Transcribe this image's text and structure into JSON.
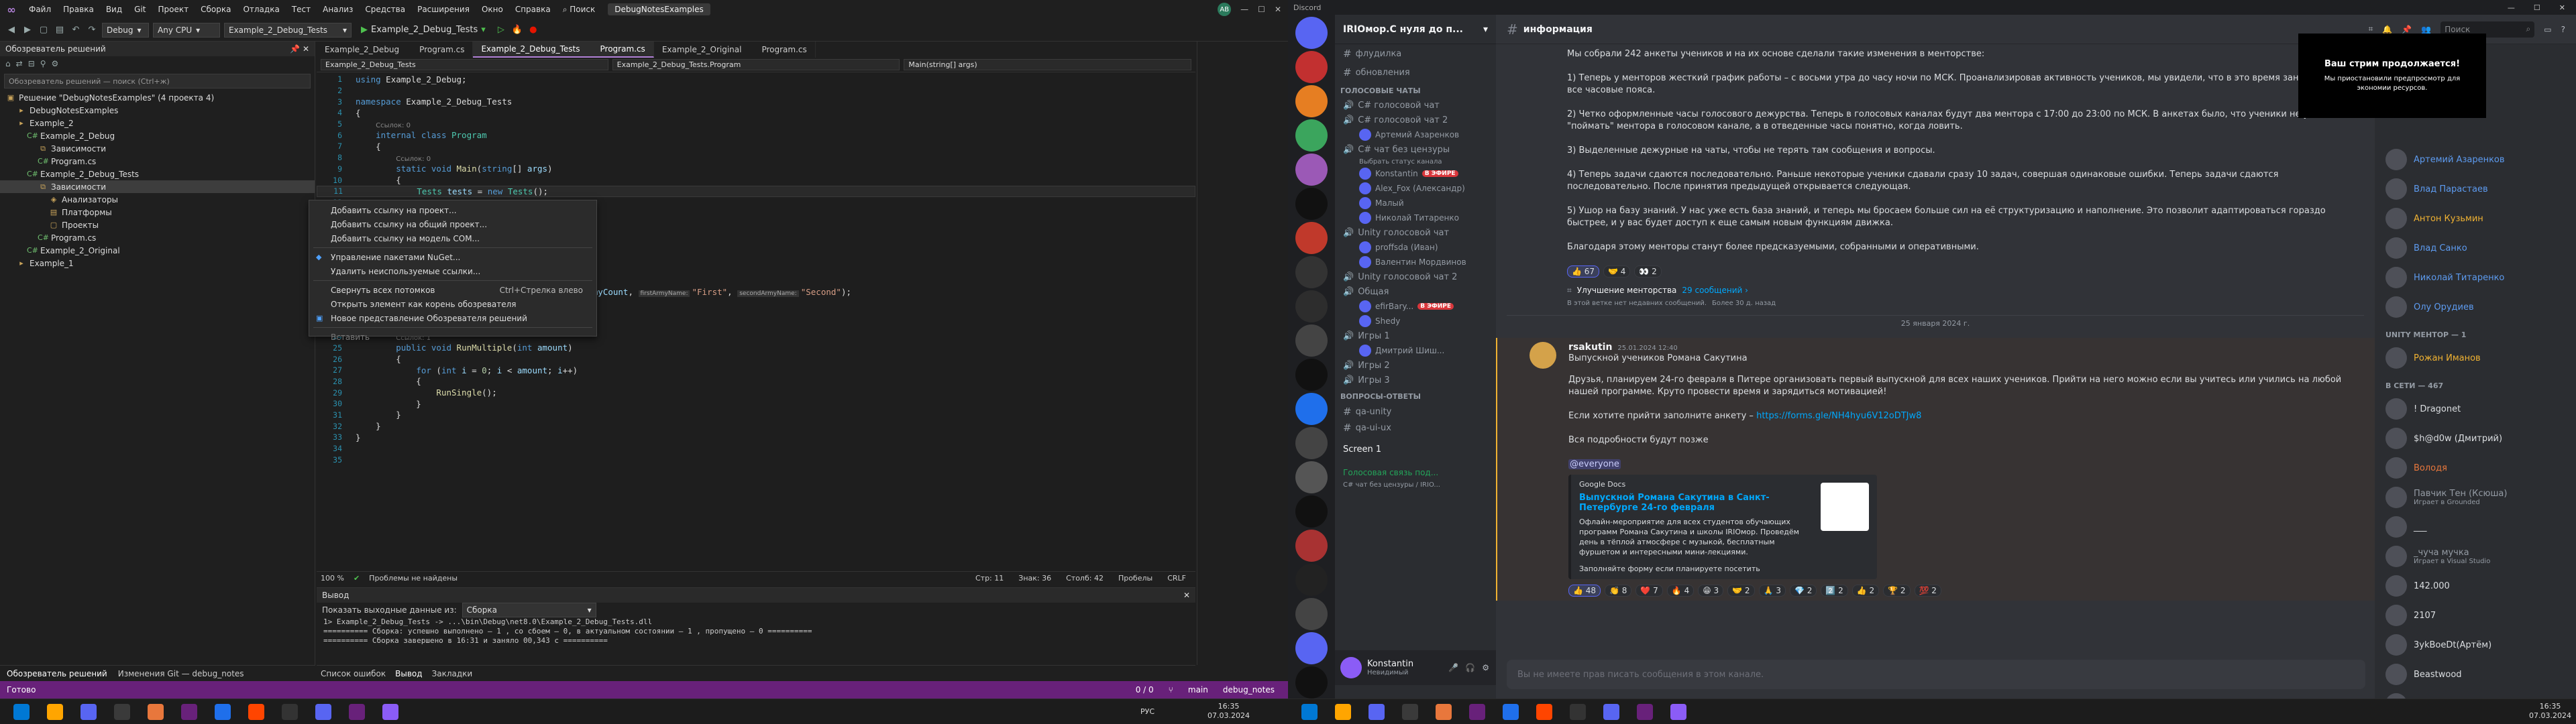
{
  "vs": {
    "menu": [
      "Файл",
      "Правка",
      "Вид",
      "Git",
      "Проект",
      "Сборка",
      "Отладка",
      "Тест",
      "Анализ",
      "Средства",
      "Расширения",
      "Окно",
      "Справка"
    ],
    "search": "Поиск",
    "solution_badge": "DebugNotesExamples",
    "avatar": "AB",
    "toolbar": {
      "config": "Debug",
      "platform": "Any CPU",
      "startup": "Example_2_Debug_Tests",
      "run_label": "Example_2_Debug_Tests"
    },
    "solution_explorer": {
      "title": "Обозреватель решений",
      "search_placeholder": "Обозреватель решений — поиск (Ctrl+ж)",
      "items": [
        {
          "label": "Решение \"DebugNotesExamples\" (4 проекта 4)",
          "indent": 0,
          "icon": "solution-icon"
        },
        {
          "label": "DebugNotesExamples",
          "indent": 1,
          "icon": "folder-icon"
        },
        {
          "label": "Example_2",
          "indent": 1,
          "icon": "folder-icon"
        },
        {
          "label": "Example_2_Debug",
          "indent": 2,
          "icon": "project-icon"
        },
        {
          "label": "Зависимости",
          "indent": 3,
          "icon": "dependencies-icon"
        },
        {
          "label": "Program.cs",
          "indent": 3,
          "icon": "csharp-file-icon"
        },
        {
          "label": "Example_2_Debug_Tests",
          "indent": 2,
          "icon": "project-icon"
        },
        {
          "label": "Зависимости",
          "indent": 3,
          "icon": "dependencies-icon",
          "selected": true
        },
        {
          "label": "Анализаторы",
          "indent": 4,
          "icon": "analyzer-icon"
        },
        {
          "label": "Платформы",
          "indent": 4,
          "icon": "framework-icon"
        },
        {
          "label": "Проекты",
          "indent": 4,
          "icon": "projects-icon"
        },
        {
          "label": "Program.cs",
          "indent": 3,
          "icon": "csharp-file-icon"
        },
        {
          "label": "Example_2_Original",
          "indent": 2,
          "icon": "project-icon"
        },
        {
          "label": "Example_1",
          "indent": 1,
          "icon": "folder-icon"
        }
      ],
      "tabs": [
        "Обозреватель решений",
        "Изменения Git — debug_notes"
      ]
    },
    "context_menu": [
      {
        "label": "Добавить ссылку на проект...",
        "icon": "",
        "shortcut": ""
      },
      {
        "label": "Добавить ссылку на общий проект...",
        "icon": "",
        "shortcut": ""
      },
      {
        "label": "Добавить ссылку на модель COM...",
        "icon": "",
        "shortcut": ""
      },
      {
        "sep": true
      },
      {
        "label": "Управление пакетами NuGet...",
        "icon": "◆",
        "shortcut": ""
      },
      {
        "label": "Удалить неиспользуемые ссылки...",
        "icon": "",
        "shortcut": ""
      },
      {
        "sep": true
      },
      {
        "label": "Свернуть всех потомков",
        "icon": "",
        "shortcut": "Ctrl+Стрелка влево"
      },
      {
        "label": "Открыть элемент как корень обозревателя",
        "icon": "",
        "shortcut": ""
      },
      {
        "label": "Новое представление Обозревателя решений",
        "icon": "▣",
        "shortcut": ""
      },
      {
        "sep": true
      },
      {
        "label": "Вставить",
        "icon": "",
        "shortcut": "",
        "disabled": true
      }
    ],
    "editor": {
      "tabs": [
        "Example_2_Debug",
        "Program.cs",
        "Example_2_Debug_Tests",
        "Program.cs",
        "Example_2_Original",
        "Program.cs"
      ],
      "active_tab": 1,
      "nav": [
        "Example_2_Debug_Tests",
        "Example_2_Debug_Tests.Program",
        "Main(string[] args)"
      ],
      "status": {
        "zoom": "100 %",
        "problems": "Проблемы не найдены",
        "line": "Стр: 11",
        "col": "Знак: 36",
        "pos": "Столб: 42",
        "ins": "Пробелы",
        "eol": "CRLF"
      }
    },
    "output": {
      "title": "Вывод",
      "show_from": "Показать выходные данные из:",
      "source": "Сборка",
      "lines": [
        "1> Example_2_Debug_Tests -> ...\\bin\\Debug\\net8.0\\Example_2_Debug_Tests.dll",
        "========== Сборка: успешно выполнено — 1 , со сбоем — 0, в актуальном состоянии — 1 , пропущено — 0 ==========",
        "========== Сборка завершено в 16:31 и заняло 00,343 с =========="
      ],
      "tabs": [
        "Список ошибок",
        "Вывод",
        "Закладки"
      ]
    },
    "statusbar": {
      "ready": "Готово",
      "errors": "0 / 0",
      "branch": "main",
      "repo": "debug_notes"
    }
  },
  "code": [
    {
      "n": 1,
      "html": "<span class=kw>using</span> Example_2_Debug;"
    },
    {
      "n": 2,
      "html": ""
    },
    {
      "n": 3,
      "html": "<span class=kw>namespace</span> Example_2_Debug_Tests"
    },
    {
      "n": 4,
      "html": "{"
    },
    {
      "n": 5,
      "html": "    <span class=cm>Ссылок: 0</span>"
    },
    {
      "n": 6,
      "html": "    <span class=kw>internal class</span> <span class=ty>Program</span>"
    },
    {
      "n": 7,
      "html": "    {"
    },
    {
      "n": 8,
      "html": "        <span class=cm>Ссылок: 0</span>"
    },
    {
      "n": 9,
      "html": "        <span class=kw>static void</span> <span class=fn>Main</span>(<span class=kw>string</span>[] <span class=vr>args</span>)"
    },
    {
      "n": 10,
      "html": "        {"
    },
    {
      "n": 11,
      "html": "            <span class=ty>Tests</span> <span class=vr>tests</span> = <span class=kw>new</span> <span class=ty>Tests</span>();"
    },
    {
      "n": 12,
      "html": ""
    },
    {
      "n": 13,
      "html": ""
    },
    {
      "n": 14,
      "html": ""
    },
    {
      "n": 15,
      "html": ""
    },
    {
      "n": 16,
      "html": ""
    },
    {
      "n": 17,
      "html": ""
    },
    {
      "n": 18,
      "html": ""
    },
    {
      "n": 19,
      "html": ""
    },
    {
      "n": 20,
      "html": "            <span class=ty>WarField</span> <span class=vr>warField</span> = <span class=kw>new</span> <span class=ty>WarField</span>(<span class=vr>armyCount</span>, <span class=hint>firstArmyName:</span><span class=st>\"First\"</span>, <span class=hint>secondArmyName:</span><span class=st>\"Second\"</span>);"
    },
    {
      "n": 21,
      "html": ""
    },
    {
      "n": 22,
      "html": "            <span class=vr>warField</span>.<span class=fn>BeginBattle</span>();"
    },
    {
      "n": 23,
      "html": "        }"
    },
    {
      "n": 24,
      "html": "        <span class=cm>Ссылок: 1</span>"
    },
    {
      "n": 25,
      "html": "        <span class=kw>public void</span> <span class=fn>RunMultiple</span>(<span class=kw>int</span> <span class=vr>amount</span>)"
    },
    {
      "n": 26,
      "html": "        {"
    },
    {
      "n": 27,
      "html": "            <span class=kw>for</span> (<span class=kw>int</span> <span class=vr>i</span> = <span class=nm>0</span>; <span class=vr>i</span> &lt; <span class=vr>amount</span>; <span class=vr>i</span>++)"
    },
    {
      "n": 28,
      "html": "            {"
    },
    {
      "n": 29,
      "html": "                <span class=fn>RunSingle</span>();"
    },
    {
      "n": 30,
      "html": "            }"
    },
    {
      "n": 31,
      "html": "        }"
    },
    {
      "n": 32,
      "html": "    }"
    },
    {
      "n": 33,
      "html": "}"
    },
    {
      "n": 34,
      "html": ""
    },
    {
      "n": 35,
      "html": ""
    }
  ],
  "discord": {
    "app_name": "Discord",
    "server_name": "IRIОмор.С нуля до п...",
    "channel": "информация",
    "search_placeholder": "Поиск",
    "channels_top": [
      "флудилка",
      "обновления"
    ],
    "voice_category": "ГОЛОСОВЫЕ ЧАТЫ",
    "voice_channels": [
      {
        "name": "C# голосовой чат",
        "users": []
      },
      {
        "name": "C# голосовой чат 2",
        "users": [
          "Артемий Азаренков"
        ]
      },
      {
        "name": "C# чат без цензуры",
        "sub": "Выбрать статус канала",
        "users": [
          "Konstantin",
          "Alex_Fox (Александр)",
          "Малый",
          "Николай Титаренко"
        ]
      },
      {
        "name": "Unity голосовой чат",
        "users": [
          "proffsda (Иван)",
          "Валентин Мордвинов"
        ]
      },
      {
        "name": "Unity голосовой чат 2",
        "users": []
      },
      {
        "name": "Общая",
        "users": [
          "efirBary...",
          "Shedy"
        ]
      },
      {
        "name": "Игры 1",
        "users": [
          "Дмитрий Шиш..."
        ]
      },
      {
        "name": "Игры 2",
        "users": []
      },
      {
        "name": "Игры 3",
        "users": []
      }
    ],
    "live_badge": "В ЭФИРЕ",
    "questions_category": "ВОПРОСЫ-ОТВЕТЫ",
    "question_channels": [
      "qa-unity",
      "qa-ui-ux"
    ],
    "screen_share": "Screen 1",
    "voice_status": "Голосовая связь под...",
    "voice_sub": "C# чат без цензуры / IRIO...",
    "user": {
      "name": "Konstantin",
      "status": "Невидимый"
    },
    "msgs_top": [
      "Мы собрали 242 анкеты учеников и на их основе сделали такие изменения в менторстве:",
      "1) Теперь у менторов жесткий график работы – с восьми утра до часу ночи по МСК. Проанализировав активность учеников, мы увидели, что в это время занимаются все чаcовые пояса.",
      "2) Четко оформленные часы голосового дежурства. Теперь в голосовых каналах будут два ментора с 17:00 до 23:00 по МСК. В анкетах было, что ученики не успевают \"поймать\" ментора в голосовом канале, а в отведенные часы понятно, когда ловить.",
      "3) Выделенные дежурные на чаты, чтобы не терять там сообщения и вопросы.",
      "4) Теперь задачи сдаются последовательно. Раньше некоторые ученики сдавали сразу 10 задач, совершая одинаковые ошибки. Теперь задачи сдаются последовательно. После принятия предыдущей открывается следующая.",
      "5) Ушор на базу знаний. У нас уже есть база знаний, и теперь мы бросаем больше сил на её структуризацию и наполнение. Это позволит адаптироваться гораздо быстрее, и у вас будет доступ к еще самым новым функциям движка.",
      "Благодаря этому менторы станут более предсказуемыми, собранными и оперативными."
    ],
    "reacts_top": [
      "👍 67",
      "🤝 4",
      "👀 2"
    ],
    "thread": {
      "name": "Улучшение менторства",
      "count": "29 сообщений ›",
      "sub": "В этой ветке нет недавних сообщений.",
      "age": "Более 30 д. назад"
    },
    "date_divider": "25 января 2024 г.",
    "post": {
      "author": "rsakutin",
      "time": "25.01.2024 12:40",
      "title": "Выпускной учеников Романа Сакутина",
      "body1": "Друзья, планируем 24-го февраля в Питере организовать первый выпускной для всех наших учеников. Прийти на него можно если вы учитесь или учились на любой нашей программе. Круто провести время и зарядиться мотивацией!",
      "body2": "Если хотите прийти заполните анкету –",
      "link": "https://forms.gle/NH4hyu6V12oDTJw8",
      "body3": "Вся подробности будут позже",
      "mention": "@everyone",
      "embed": {
        "provider": "Google Docs",
        "title": "Выпускной Романа Сакутина в Санкт-Петербурге 24-го февраля",
        "desc": "Офлайн-мероприятие для всех студентов обучающих программ Романа Сакутина и школы IRIОмор. Проведём день в тёплой атмосфере с музыкой, бесплатным фуршетом и интересными мини-лекциями.",
        "note": "Заполняйте форму если планируете посетить"
      },
      "reacts": [
        "👍 48",
        "👏 8",
        "❤️ 7",
        "🔥 4",
        "😁 3",
        "🤝 2",
        "🙏 3",
        "💎 2",
        "2️⃣ 2",
        "👍 2",
        "🏆 2",
        "💯 2"
      ]
    },
    "input_placeholder": "Вы не имеете прав писать сообщения в этом канале.",
    "stream_popup": {
      "title": "Ваш стрим продолжается!",
      "body": "Мы приостановили предпросмотр для экономии ресурсов."
    },
    "members": {
      "top": [
        {
          "name": "Артемий Азаренков",
          "color": "#5d9bf0"
        },
        {
          "name": "Влад Парастаев",
          "color": "#5d9bf0"
        },
        {
          "name": "Антон Кузьмин",
          "color": "#f0b232"
        },
        {
          "name": "Влад Санко",
          "color": "#5d9bf0"
        },
        {
          "name": "Николай Титаренко",
          "color": "#5d9bf0"
        },
        {
          "name": "Олу Орудиев",
          "color": "#5d9bf0"
        }
      ],
      "mentor_cat": "UNITY МЕНТОР — 1",
      "mentor": [
        {
          "name": "Рожан Иманов",
          "color": "#f0b232"
        }
      ],
      "online_cat": "В СЕТИ — 467",
      "online": [
        {
          "name": "! Dragonet",
          "color": "#dbdee1"
        },
        {
          "name": "$h@d0w (Дмитрий)",
          "color": "#dbdee1"
        },
        {
          "name": "Володя",
          "color": "#e8773c"
        },
        {
          "name": "Павчик Тен (Ксюша)",
          "color": "#949ba4",
          "sub": "Играет в Grounded"
        },
        {
          "name": "___",
          "color": "#dbdee1"
        },
        {
          "name": "_чуча мучка",
          "color": "#949ba4",
          "sub": "Играет в Visual Studio"
        },
        {
          "name": "142.000",
          "color": "#dbdee1"
        },
        {
          "name": "2107",
          "color": "#dbdee1"
        },
        {
          "name": "3ykBoeDt(Артём)",
          "color": "#dbdee1"
        },
        {
          "name": "Beastwood",
          "color": "#dbdee1"
        },
        {
          "name": "[Nonntori(Илья)",
          "color": "#dbdee1"
        }
      ]
    }
  },
  "taskbar": {
    "lang": "РУС",
    "time": "16:35",
    "date": "07.03.2024"
  }
}
